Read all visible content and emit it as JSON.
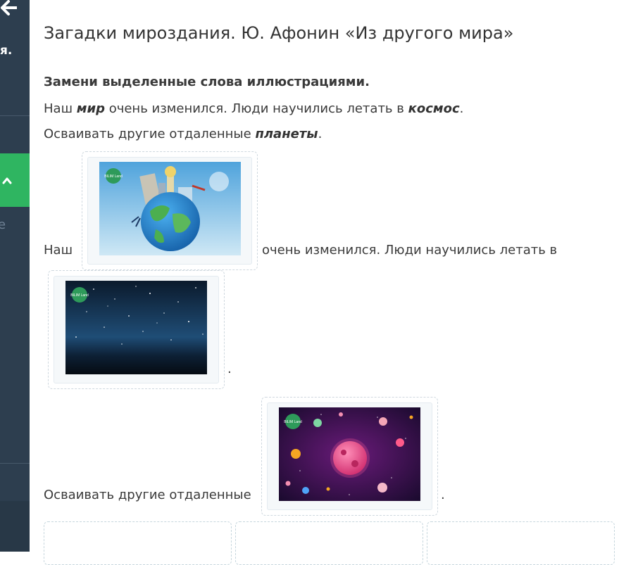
{
  "sidebar": {
    "back_icon": "arrow-left-icon",
    "partial_text": "я.",
    "faint_text": "е",
    "active_color": "#2fb561"
  },
  "page": {
    "title": "Загадки мироздания. Ю. Афонин «Из другого мира»",
    "instruction": "Замени выделенные слова иллюстрациями."
  },
  "sentence1": {
    "p1": "Наш ",
    "w1": "мир",
    "p2": " очень изменился. Люди научились летать в ",
    "w2": "космос",
    "p3": "."
  },
  "sentence2": {
    "p1": "Осваивать другие отдаленные ",
    "w1": "планеты",
    "p2": "."
  },
  "answer": {
    "nash": "Наш",
    "middle": "очень изменился. Люди научились летать в",
    "dot1": ".",
    "osvaivat": "Осваивать другие отдаленные",
    "dot2": "."
  },
  "images": {
    "earth_logo": "BILIM Land",
    "space_logo": "BILIM Land",
    "planets_logo": "BILIM Land"
  }
}
